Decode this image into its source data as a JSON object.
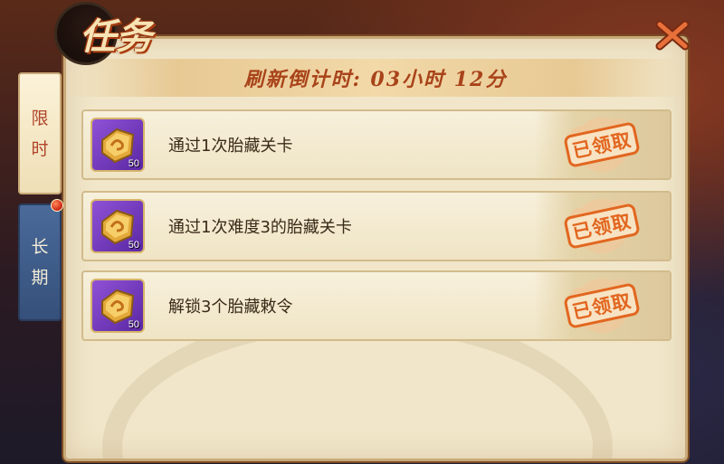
{
  "window": {
    "title": "任务",
    "close_icon": "close-x-icon"
  },
  "header": {
    "refresh_countdown": "刷新倒计时: 03小时 12分"
  },
  "tabs": [
    {
      "label_line1": "限",
      "label_line2": "时",
      "active": true
    },
    {
      "label_line1": "长",
      "label_line2": "期",
      "active": false,
      "has_notification_dot": true
    }
  ],
  "tasks": [
    {
      "description": "通过1次胎藏关卡",
      "reward_icon": "gem-token-icon",
      "reward_count": "50",
      "status": "已领取"
    },
    {
      "description": "通过1次难度3的胎藏关卡",
      "reward_icon": "gem-token-icon",
      "reward_count": "50",
      "status": "已领取"
    },
    {
      "description": "解锁3个胎藏敕令",
      "reward_icon": "gem-token-icon",
      "reward_count": "50",
      "status": "已领取"
    }
  ],
  "colors": {
    "parchment": "#f1e6c9",
    "accent_orange": "#e2661f",
    "title_red": "#b0442a",
    "reward_purple": "#8f52d6",
    "tab_blue": "#4a6a9a"
  }
}
